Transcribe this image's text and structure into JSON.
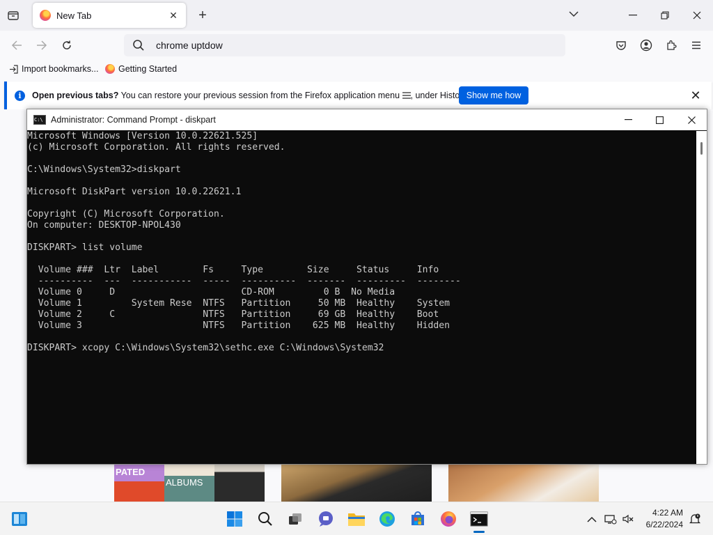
{
  "browser": {
    "tab": {
      "title": "New Tab"
    },
    "url_value": "chrome uptdow",
    "bookmarks": [
      {
        "label": "Import bookmarks...",
        "icon": "import-icon"
      },
      {
        "label": "Getting Started",
        "icon": "firefox-icon"
      }
    ],
    "infobar": {
      "bold_text": "Open previous tabs?",
      "text_before_menu": " You can restore your previous session from the Firefox application menu ",
      "text_after_menu": ", under History.",
      "button_label": "Show me how"
    },
    "tiles": {
      "tile1_label_a": "PATED",
      "tile1_label_b": "ALBUMS"
    }
  },
  "cmd_window": {
    "title": "Administrator: Command Prompt - diskpart",
    "lines": [
      "Microsoft Windows [Version 10.0.22621.525]",
      "(c) Microsoft Corporation. All rights reserved.",
      "",
      "C:\\Windows\\System32>diskpart",
      "",
      "Microsoft DiskPart version 10.0.22621.1",
      "",
      "Copyright (C) Microsoft Corporation.",
      "On computer: DESKTOP-NPOL430",
      "",
      "DISKPART> list volume",
      "",
      "  Volume ###  Ltr  Label        Fs     Type        Size     Status     Info",
      "  ----------  ---  -----------  -----  ----------  -------  ---------  --------",
      "  Volume 0     D                       CD-ROM         0 B  No Media",
      "  Volume 1         System Rese  NTFS   Partition     50 MB  Healthy    System",
      "  Volume 2     C                NTFS   Partition     69 GB  Healthy    Boot",
      "  Volume 3                      NTFS   Partition    625 MB  Healthy    Hidden",
      "",
      "DISKPART> xcopy C:\\Windows\\System32\\sethc.exe C:\\Windows\\System32"
    ]
  },
  "taskbar": {
    "time": "4:22 AM",
    "date": "6/22/2024",
    "icons": [
      "start-icon",
      "search-icon",
      "task-view-icon",
      "chat-icon",
      "file-explorer-icon",
      "edge-icon",
      "store-icon",
      "firefox-icon",
      "cmd-icon"
    ]
  },
  "colors": {
    "accent": "#0061e0",
    "console_bg": "#0c0c0c",
    "console_text": "#cccccc"
  }
}
